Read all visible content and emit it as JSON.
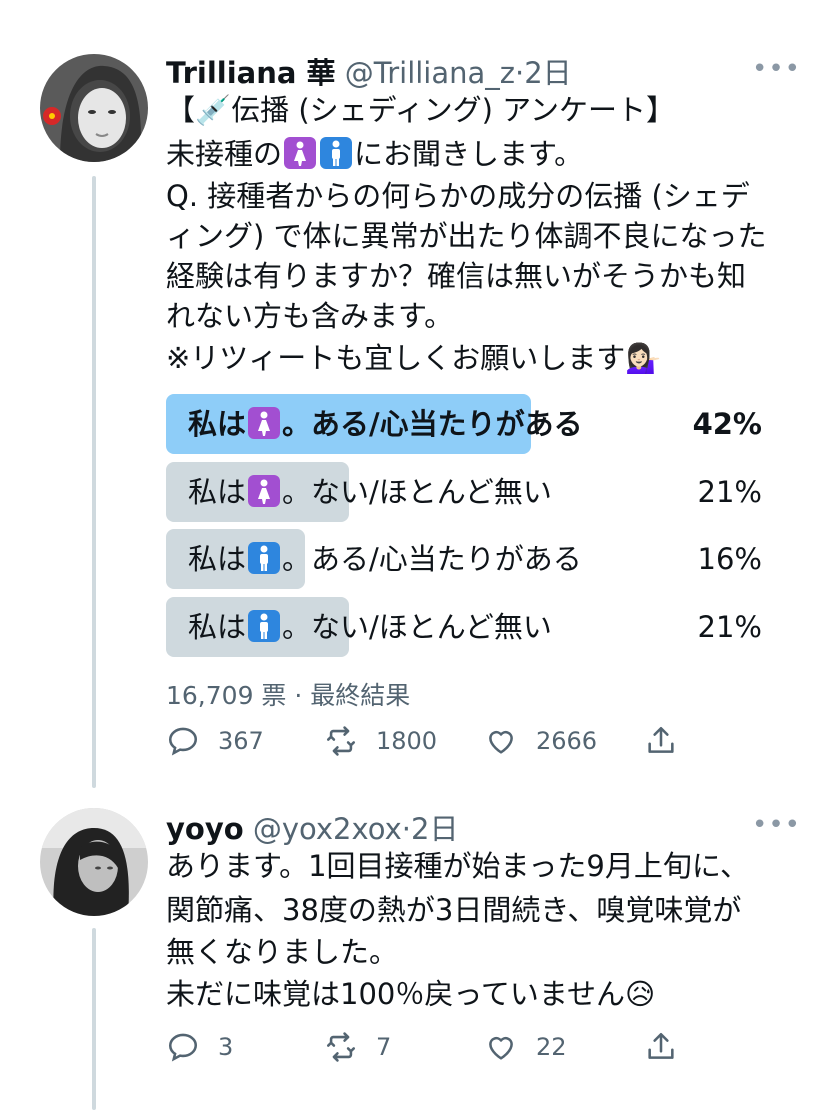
{
  "tweet1": {
    "name": "Trilliana 華",
    "handle": "@Trilliana_z",
    "time": "2日",
    "more": "•••",
    "lines": [
      "【💉伝播 (シェディング) アンケート】",
      "未接種の",
      "にお聞きします。",
      "Q. 接種者からの何らかの成分の伝播 (シェデ",
      "ィング) で体に異常が出たり体調不良になった",
      "経験は有りますか？確信は無いがそうかも知",
      "れない方も含みます。",
      "※リツィートも宜しくお願いします💁🏻‍♀️"
    ],
    "poll": {
      "options": [
        {
          "prefix": "私は",
          "suffix": "。ある/心当たりがある",
          "percent": "42%",
          "value": 42,
          "icon": "womens-icon",
          "leading": true
        },
        {
          "prefix": "私は",
          "suffix": "。ない/ほとんど無い",
          "percent": "21%",
          "value": 21,
          "icon": "womens-icon",
          "leading": false
        },
        {
          "prefix": "私は",
          "suffix": "。ある/心当たりがある",
          "percent": "16%",
          "value": 16,
          "icon": "mens-icon",
          "leading": false
        },
        {
          "prefix": "私は",
          "suffix": "。ない/ほとんど無い",
          "percent": "21%",
          "value": 21,
          "icon": "mens-icon",
          "leading": false
        }
      ],
      "votes": "16,709 票",
      "status": "最終結果"
    },
    "actions": {
      "replies": "367",
      "retweets": "1800",
      "likes": "2666"
    }
  },
  "tweet2": {
    "name": "yoyo",
    "handle": "@yox2xox",
    "time": "2日",
    "more": "•••",
    "lines": [
      "あります。1回目接種が始まった9月上旬に、",
      "関節痛、38度の熱が3日間続き、嗅覚味覚が",
      "無くなりました。",
      "未だに味覚は100％戻っていません😥"
    ],
    "actions": {
      "replies": "3",
      "retweets": "7",
      "likes": "22"
    }
  },
  "colors": {
    "leading_bar": "#8ecdf8",
    "bar": "#cfd9de",
    "womens": "#a24fd1",
    "mens": "#2e86de",
    "secondary_text": "#536471"
  },
  "icons": [
    "reply-icon",
    "retweet-icon",
    "like-icon",
    "share-icon",
    "more-icon",
    "syringe-icon",
    "womens-icon",
    "mens-icon"
  ]
}
